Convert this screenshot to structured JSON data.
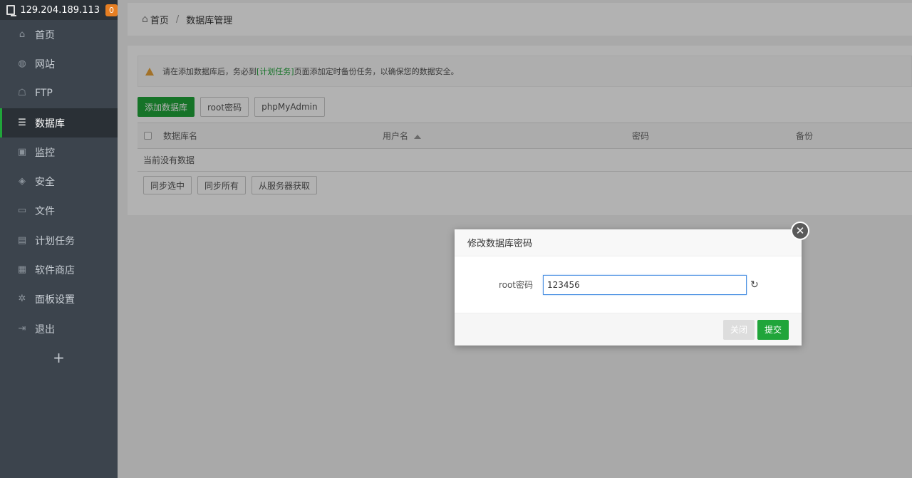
{
  "sidebar": {
    "server_ip": "129.204.189.113",
    "badge": "0",
    "items": [
      {
        "label": "首页",
        "icon": "home-icon",
        "glyph": "⌂"
      },
      {
        "label": "网站",
        "icon": "globe-icon",
        "glyph": "◍"
      },
      {
        "label": "FTP",
        "icon": "ftp-icon",
        "glyph": "☖"
      },
      {
        "label": "数据库",
        "icon": "database-icon",
        "glyph": "☰"
      },
      {
        "label": "监控",
        "icon": "monitor-icon",
        "glyph": "▣"
      },
      {
        "label": "安全",
        "icon": "shield-icon",
        "glyph": "◈"
      },
      {
        "label": "文件",
        "icon": "folder-icon",
        "glyph": "▭"
      },
      {
        "label": "计划任务",
        "icon": "calendar-icon",
        "glyph": "▤"
      },
      {
        "label": "软件商店",
        "icon": "apps-icon",
        "glyph": "▦"
      },
      {
        "label": "面板设置",
        "icon": "gear-icon",
        "glyph": "✲"
      },
      {
        "label": "退出",
        "icon": "logout-icon",
        "glyph": "⇥"
      }
    ],
    "add_label": "+"
  },
  "breadcrumb": {
    "home": "首页",
    "separator": "/",
    "current": "数据库管理"
  },
  "alert": {
    "text_before": "请在添加数据库后，务必到",
    "link": "[计划任务]",
    "text_after": "页面添加定时备份任务，以确保您的数据安全。"
  },
  "toolbar": {
    "add_db": "添加数据库",
    "root_pwd": "root密码",
    "phpmyadmin": "phpMyAdmin"
  },
  "table": {
    "columns": [
      "数据库名",
      "用户名",
      "密码",
      "备份"
    ],
    "empty": "当前没有数据"
  },
  "bottom_buttons": [
    "同步选中",
    "同步所有",
    "从服务器获取"
  ],
  "modal": {
    "title": "修改数据库密码",
    "field_label": "root密码",
    "field_value": "123456",
    "close_label": "关闭",
    "submit_label": "提交"
  },
  "colors": {
    "accent": "#20a53a",
    "sidebar_bg": "#3c444d",
    "warning": "#e8a33a"
  }
}
